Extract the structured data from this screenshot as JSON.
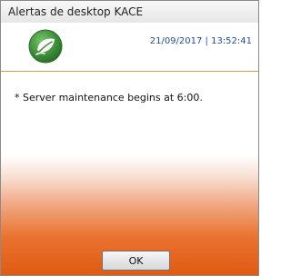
{
  "window": {
    "title": "Alertas de desktop KACE"
  },
  "header": {
    "logo_icon": "leaf-circle-icon",
    "timestamp": "21/09/2017 | 13:52:41"
  },
  "message": {
    "text": "* Server maintenance begins at 6:00."
  },
  "footer": {
    "ok_label": "OK"
  },
  "colors": {
    "accent_orange": "#e05a12",
    "divider_gold": "#c9a34b",
    "timestamp_blue": "#1f4e9c",
    "logo_green": "#3f8f3a"
  }
}
